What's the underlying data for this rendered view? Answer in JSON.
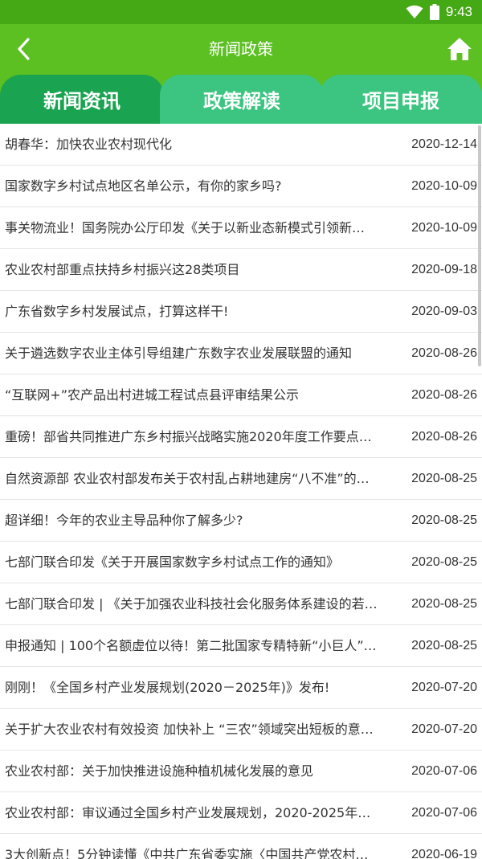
{
  "status_bar": {
    "time": "9:43"
  },
  "app_bar": {
    "title": "新闻政策",
    "back_icon": "chevron-left-icon",
    "home_icon": "home-icon"
  },
  "tabs": [
    {
      "label": "新闻资讯",
      "active": true
    },
    {
      "label": "政策解读",
      "active": false
    },
    {
      "label": "项目申报",
      "active": false
    }
  ],
  "colors": {
    "status_bar": "#45a815",
    "app_bar": "#5cbf22",
    "tab_active": "#1aa350",
    "tab_inactive": "#3cc581"
  },
  "news": [
    {
      "title": "胡春华：加快农业农村现代化",
      "date": "2020-12-14"
    },
    {
      "title": "国家数字乡村试点地区名单公示，有你的家乡吗?",
      "date": "2020-10-09"
    },
    {
      "title": "事关物流业！国务院办公厅印发《关于以新业态新模式引领新…",
      "date": "2020-10-09"
    },
    {
      "title": "农业农村部重点扶持乡村振兴这28类项目",
      "date": "2020-09-18"
    },
    {
      "title": "广东省数字乡村发展试点，打算这样干!",
      "date": "2020-09-03"
    },
    {
      "title": "关于遴选数字农业主体引导组建广东数字农业发展联盟的通知",
      "date": "2020-08-26"
    },
    {
      "title": "“互联网+”农产品出村进城工程试点县评审结果公示",
      "date": "2020-08-26"
    },
    {
      "title": "重磅！部省共同推进广东乡村振兴战略实施2020年度工作要点…",
      "date": "2020-08-26"
    },
    {
      "title": "自然资源部 农业农村部发布关于农村乱占耕地建房“八不准”的…",
      "date": "2020-08-25"
    },
    {
      "title": "超详细！今年的农业主导品种你了解多少?",
      "date": "2020-08-25"
    },
    {
      "title": "七部门联合印发《关于开展国家数字乡村试点工作的通知》",
      "date": "2020-08-25"
    },
    {
      "title": "七部门联合印发 | 《关于加强农业科技社会化服务体系建设的若…",
      "date": "2020-08-25"
    },
    {
      "title": "申报通知 | 100个名额虚位以待！第二批国家专精特新“小巨人”…",
      "date": "2020-08-25"
    },
    {
      "title": "刚刚！《全国乡村产业发展规划(2020－2025年)》发布!",
      "date": "2020-07-20"
    },
    {
      "title": "关于扩大农业农村有效投资 加快补上 “三农”领域突出短板的意…",
      "date": "2020-07-20"
    },
    {
      "title": "农业农村部：关于加快推进设施种植机械化发展的意见",
      "date": "2020-07-06"
    },
    {
      "title": "农业农村部：审议通过全国乡村产业发展规划，2020-2025年…",
      "date": "2020-07-06"
    },
    {
      "title": "3大创新点！5分钟读懂《中共广东省委实施〈中国共产党农村…",
      "date": "2020-06-19"
    }
  ]
}
